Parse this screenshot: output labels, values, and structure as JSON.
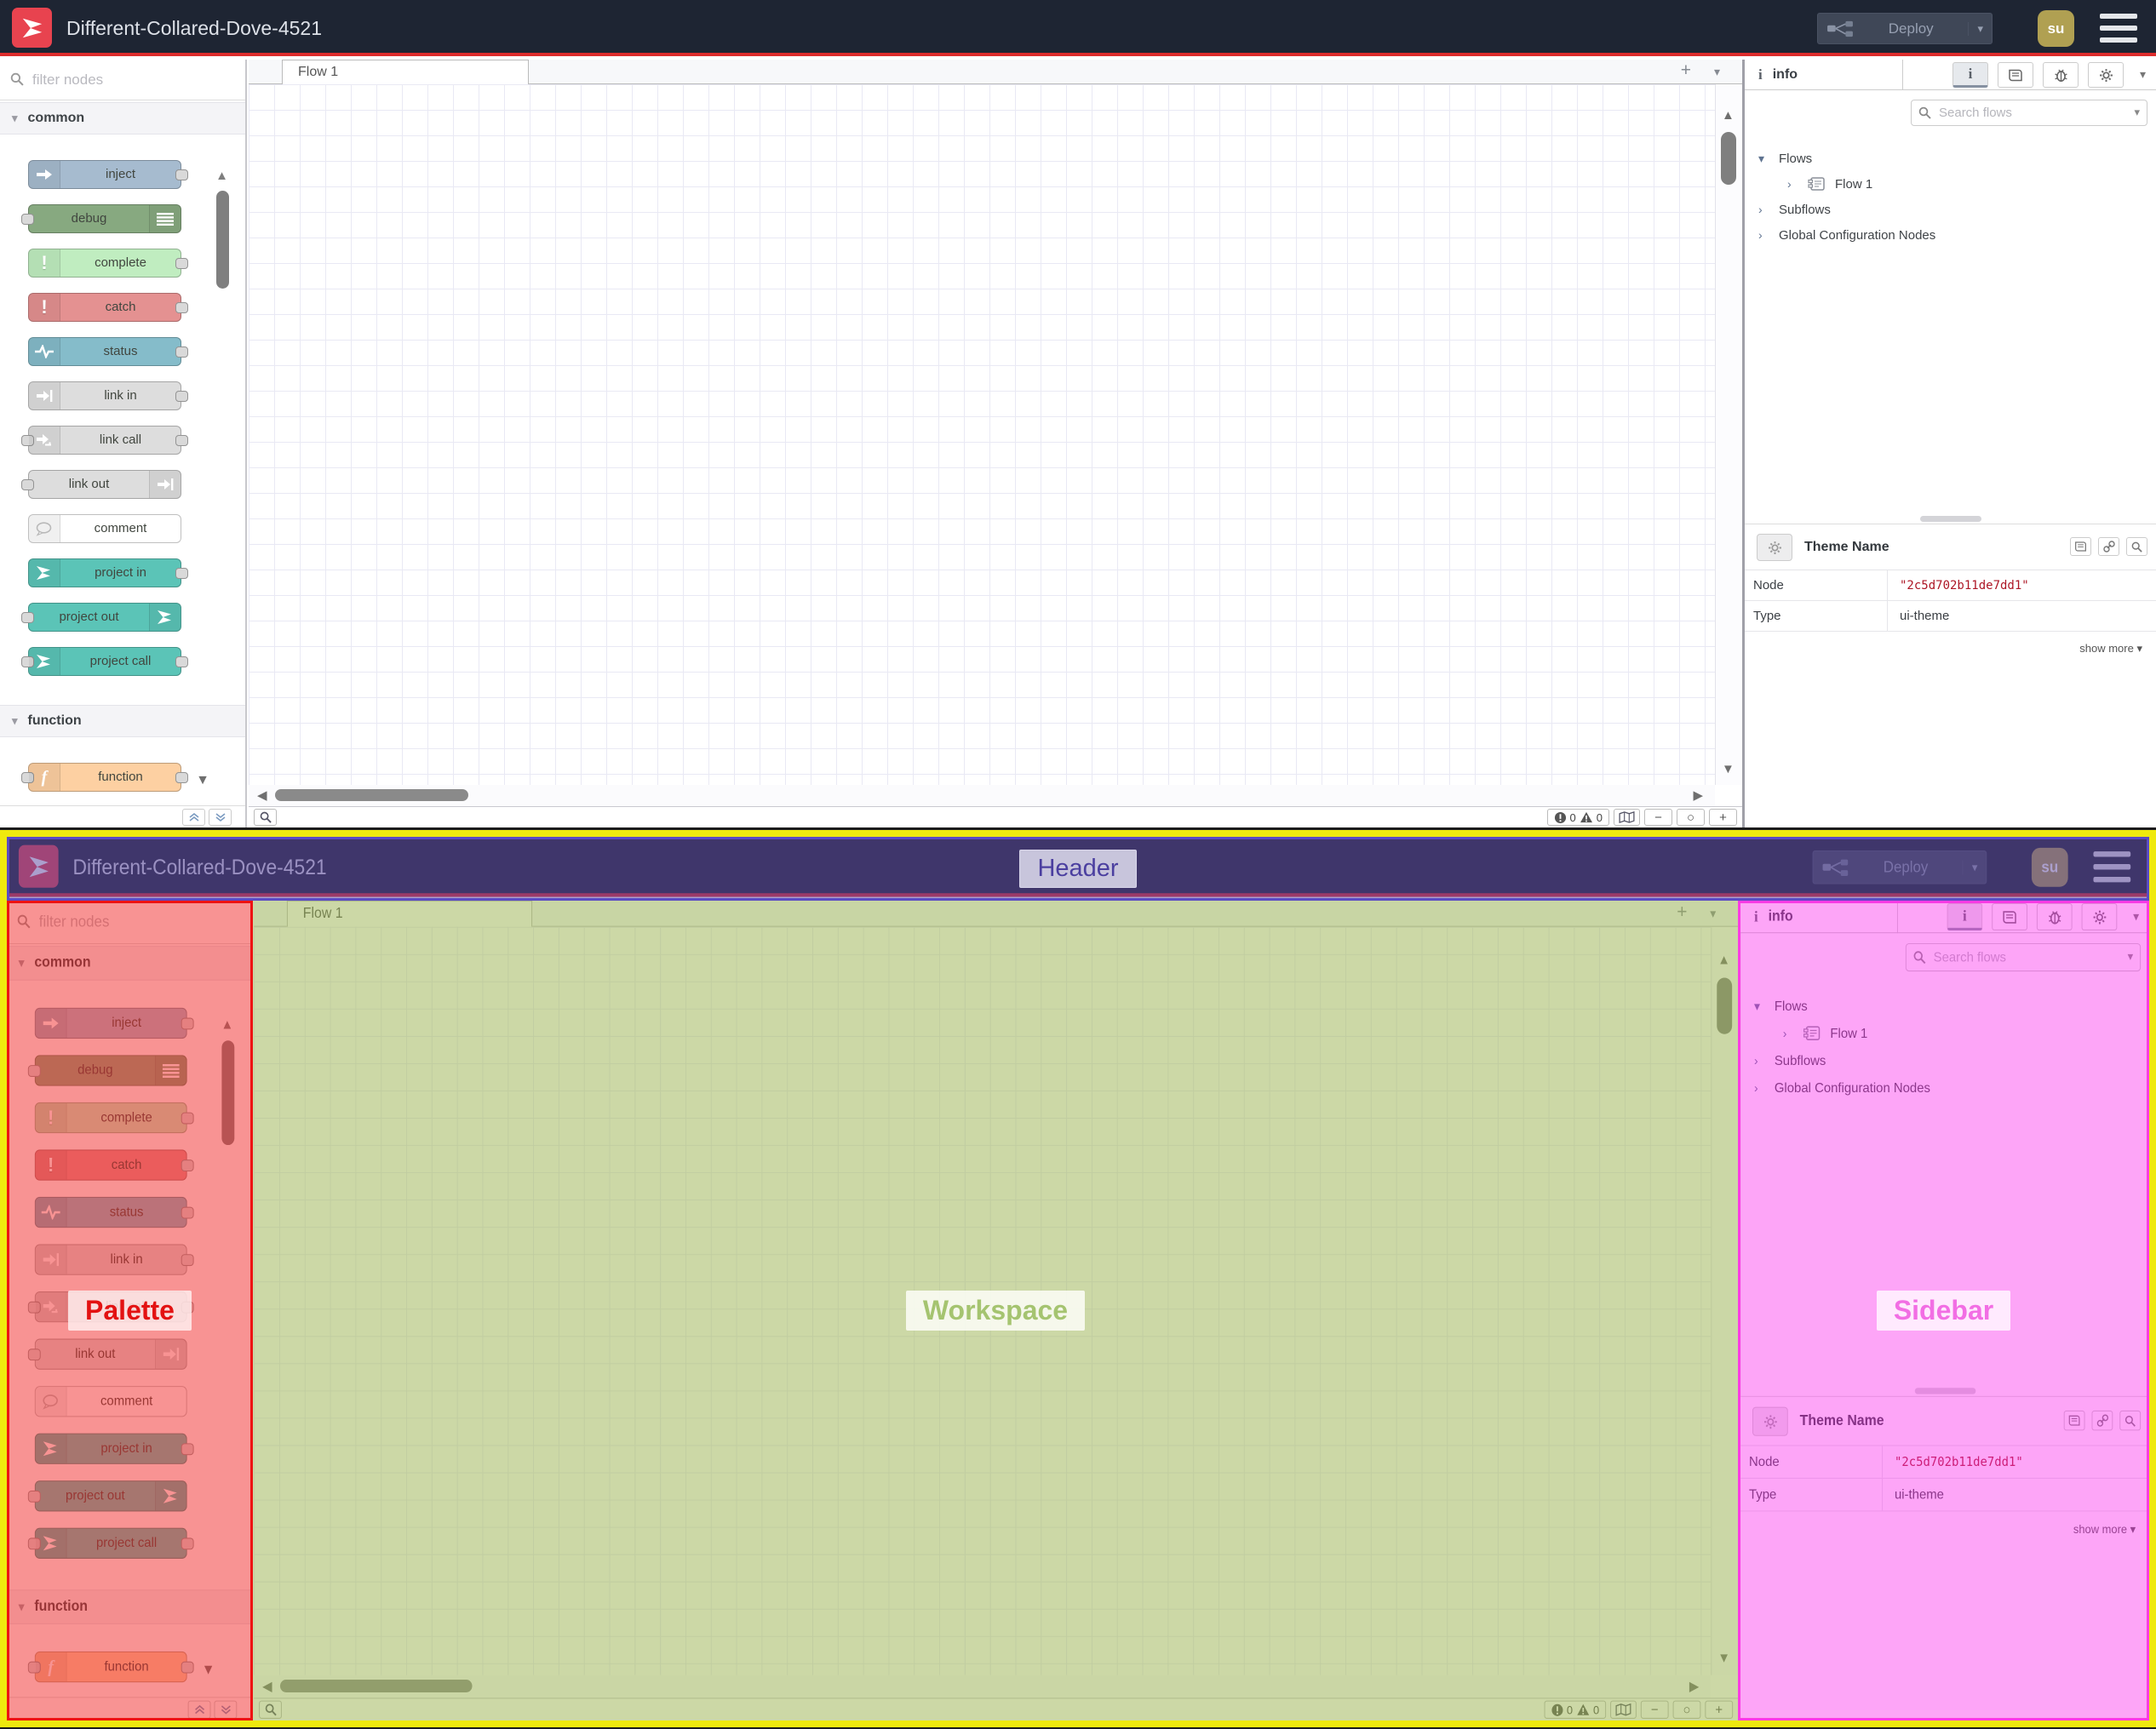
{
  "header": {
    "title": "Different-Collared-Dove-4521",
    "deploy_label": "Deploy",
    "avatar_text": "su",
    "colors": {
      "bar": "#1e2533",
      "underline": "#dd2c2c",
      "logo": "#e8434f",
      "avatar": "#b0a052"
    }
  },
  "palette": {
    "filter_placeholder": "filter nodes",
    "sections": [
      {
        "label": "common",
        "nodes": [
          {
            "label": "inject",
            "color": "#a6bbcf",
            "icon": "inject-arrow-icon",
            "icon_side": "left",
            "ports": "out"
          },
          {
            "label": "debug",
            "color": "#87a980",
            "icon": "debug-list-icon",
            "icon_side": "right",
            "ports": "in"
          },
          {
            "label": "complete",
            "color": "#c0edc0",
            "icon": "exclamation-icon",
            "icon_side": "left",
            "ports": "out"
          },
          {
            "label": "catch",
            "color": "#e49191",
            "icon": "exclamation-icon",
            "icon_side": "left",
            "ports": "out"
          },
          {
            "label": "status",
            "color": "#85bcca",
            "icon": "heartbeat-icon",
            "icon_side": "left",
            "ports": "out"
          },
          {
            "label": "link in",
            "color": "#dddddd",
            "icon": "link-icon",
            "icon_side": "left",
            "ports": "out"
          },
          {
            "label": "link call",
            "color": "#dddddd",
            "icon": "link-call-icon",
            "icon_side": "left",
            "ports": "both"
          },
          {
            "label": "link out",
            "color": "#dddddd",
            "icon": "link-icon",
            "icon_side": "right",
            "ports": "in"
          },
          {
            "label": "comment",
            "color": "#ffffff",
            "icon": "comment-icon",
            "icon_side": "left",
            "ports": "none"
          },
          {
            "label": "project in",
            "color": "#5bc4b7",
            "icon": "project-icon",
            "icon_side": "left",
            "ports": "out"
          },
          {
            "label": "project out",
            "color": "#5bc4b7",
            "icon": "project-icon",
            "icon_side": "right",
            "ports": "in"
          },
          {
            "label": "project call",
            "color": "#5bc4b7",
            "icon": "project-icon",
            "icon_side": "left",
            "ports": "both"
          }
        ]
      },
      {
        "label": "function",
        "nodes": [
          {
            "label": "function",
            "color": "#fdd0a2",
            "icon": "function-icon",
            "icon_side": "left",
            "ports": "both"
          }
        ]
      }
    ]
  },
  "workspace": {
    "tab_label": "Flow 1",
    "add_tab_label": "+",
    "status": {
      "errors": "0",
      "warnings": "0"
    },
    "zoom": {
      "out": "−",
      "reset": "○",
      "in": "+"
    }
  },
  "sidebar": {
    "active_tab": "info",
    "search_placeholder": "Search flows",
    "tree": {
      "flows_label": "Flows",
      "flow1_label": "Flow 1",
      "subflows_label": "Subflows",
      "global_label": "Global Configuration Nodes"
    },
    "detail": {
      "title": "Theme Name",
      "node_label": "Node",
      "node_value": "\"2c5d702b11de7dd1\"",
      "type_label": "Type",
      "type_value": "ui-theme",
      "show_more": "show more"
    }
  },
  "annotations": {
    "header_label": "Header",
    "palette_label": "Palette",
    "workspace_label": "Workspace",
    "sidebar_label": "Sidebar",
    "colors": {
      "outer_border": "#efe90e",
      "header": "#5b4bc4",
      "palette": "#ee1212",
      "workspace": "#99b14d",
      "sidebar": "#fb3be4"
    }
  }
}
